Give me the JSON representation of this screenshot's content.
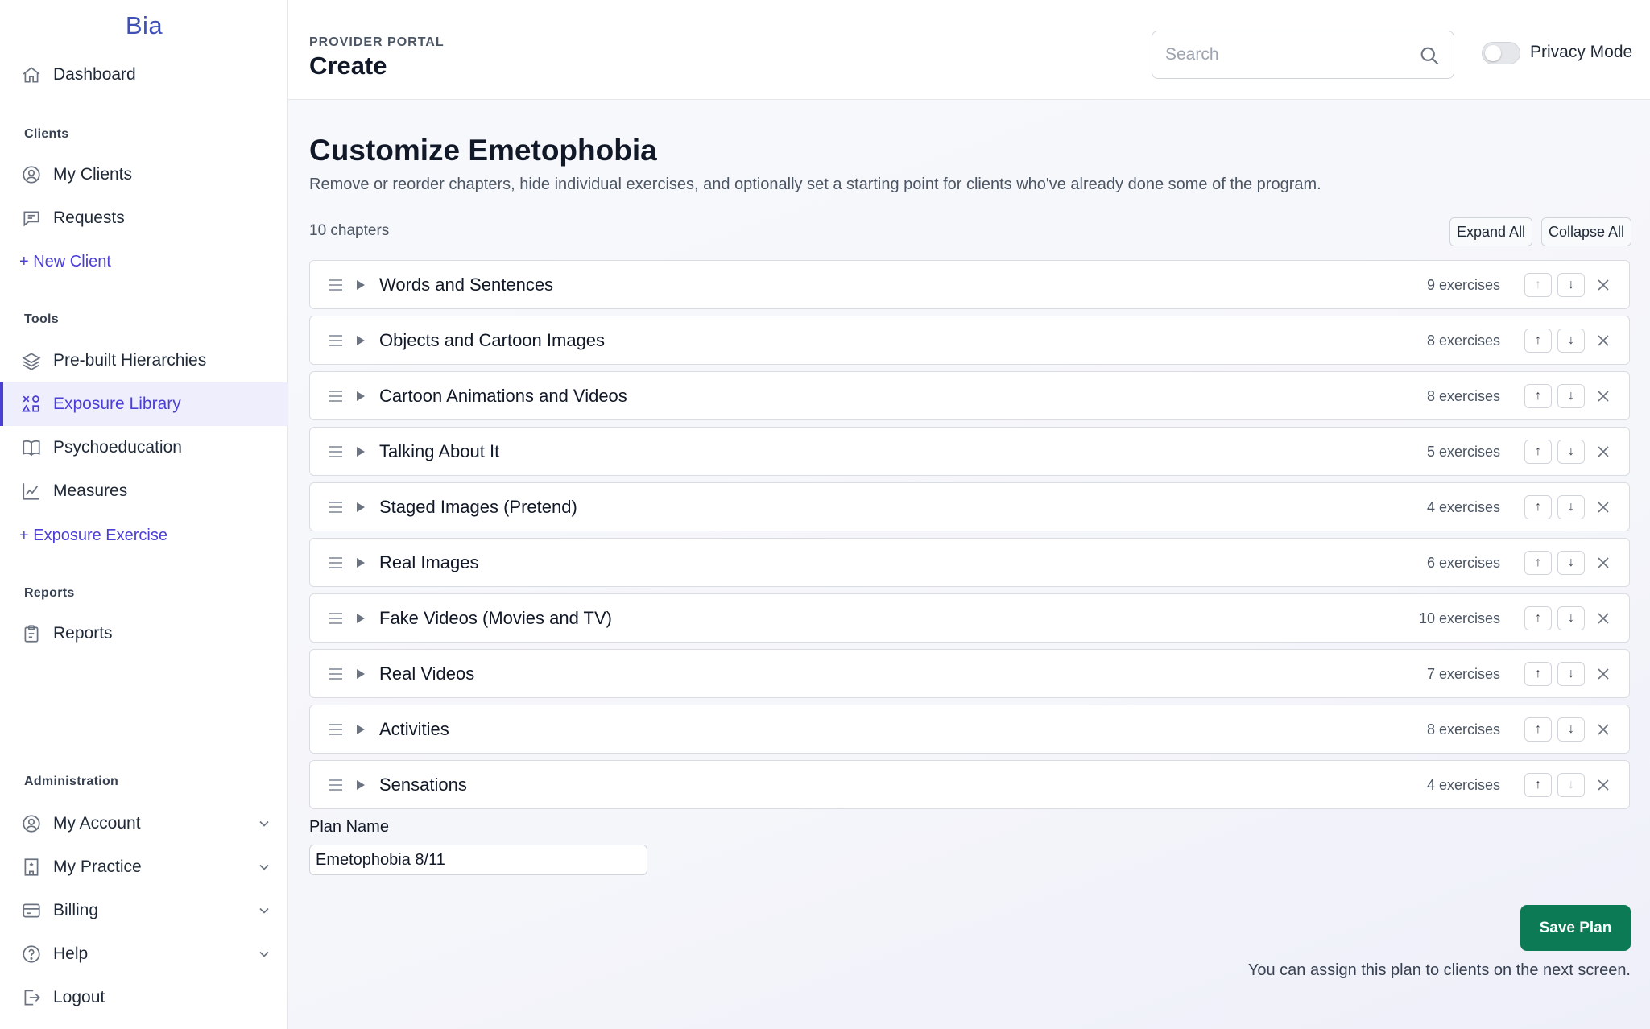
{
  "brand": "Bia",
  "sidebar": {
    "dashboard": "Dashboard",
    "sections": {
      "clients": "Clients",
      "tools": "Tools",
      "reports": "Reports",
      "administration": "Administration"
    },
    "clients_items": [
      "My Clients",
      "Requests"
    ],
    "new_client": "+ New Client",
    "tools_items": [
      "Pre-built Hierarchies",
      "Exposure Library",
      "Psychoeducation",
      "Measures"
    ],
    "new_exposure": "+ Exposure Exercise",
    "reports_items": [
      "Reports"
    ],
    "admin_items": [
      "My Account",
      "My Practice",
      "Billing",
      "Help",
      "Logout"
    ]
  },
  "header": {
    "portal_label": "PROVIDER PORTAL",
    "title": "Create",
    "search_placeholder": "Search",
    "privacy_label": "Privacy Mode"
  },
  "main": {
    "heading": "Customize Emetophobia",
    "subtitle": "Remove or reorder chapters, hide individual exercises, and optionally set a starting point for clients who've already done some of the program.",
    "chapter_count": "10 chapters",
    "expand_all": "Expand All",
    "collapse_all": "Collapse All",
    "move_up": "↑",
    "move_down": "↓",
    "chapters": [
      {
        "title": "Words and Sentences",
        "count": "9 exercises"
      },
      {
        "title": "Objects and Cartoon Images",
        "count": "8 exercises"
      },
      {
        "title": "Cartoon Animations and Videos",
        "count": "8 exercises"
      },
      {
        "title": "Talking About It",
        "count": "5 exercises"
      },
      {
        "title": "Staged Images (Pretend)",
        "count": "4 exercises"
      },
      {
        "title": "Real Images",
        "count": "6 exercises"
      },
      {
        "title": "Fake Videos (Movies and TV)",
        "count": "10 exercises"
      },
      {
        "title": "Real Videos",
        "count": "7 exercises"
      },
      {
        "title": "Activities",
        "count": "8 exercises"
      },
      {
        "title": "Sensations",
        "count": "4 exercises"
      }
    ],
    "plan_name_label": "Plan Name",
    "plan_name_value": "Emetophobia 8/11",
    "save_button": "Save Plan",
    "assign_note": "You can assign this plan to clients on the next screen."
  },
  "colors": {
    "accent": "#4b3fd6",
    "brand": "#3f51b5",
    "save_green": "#0b7a55"
  }
}
